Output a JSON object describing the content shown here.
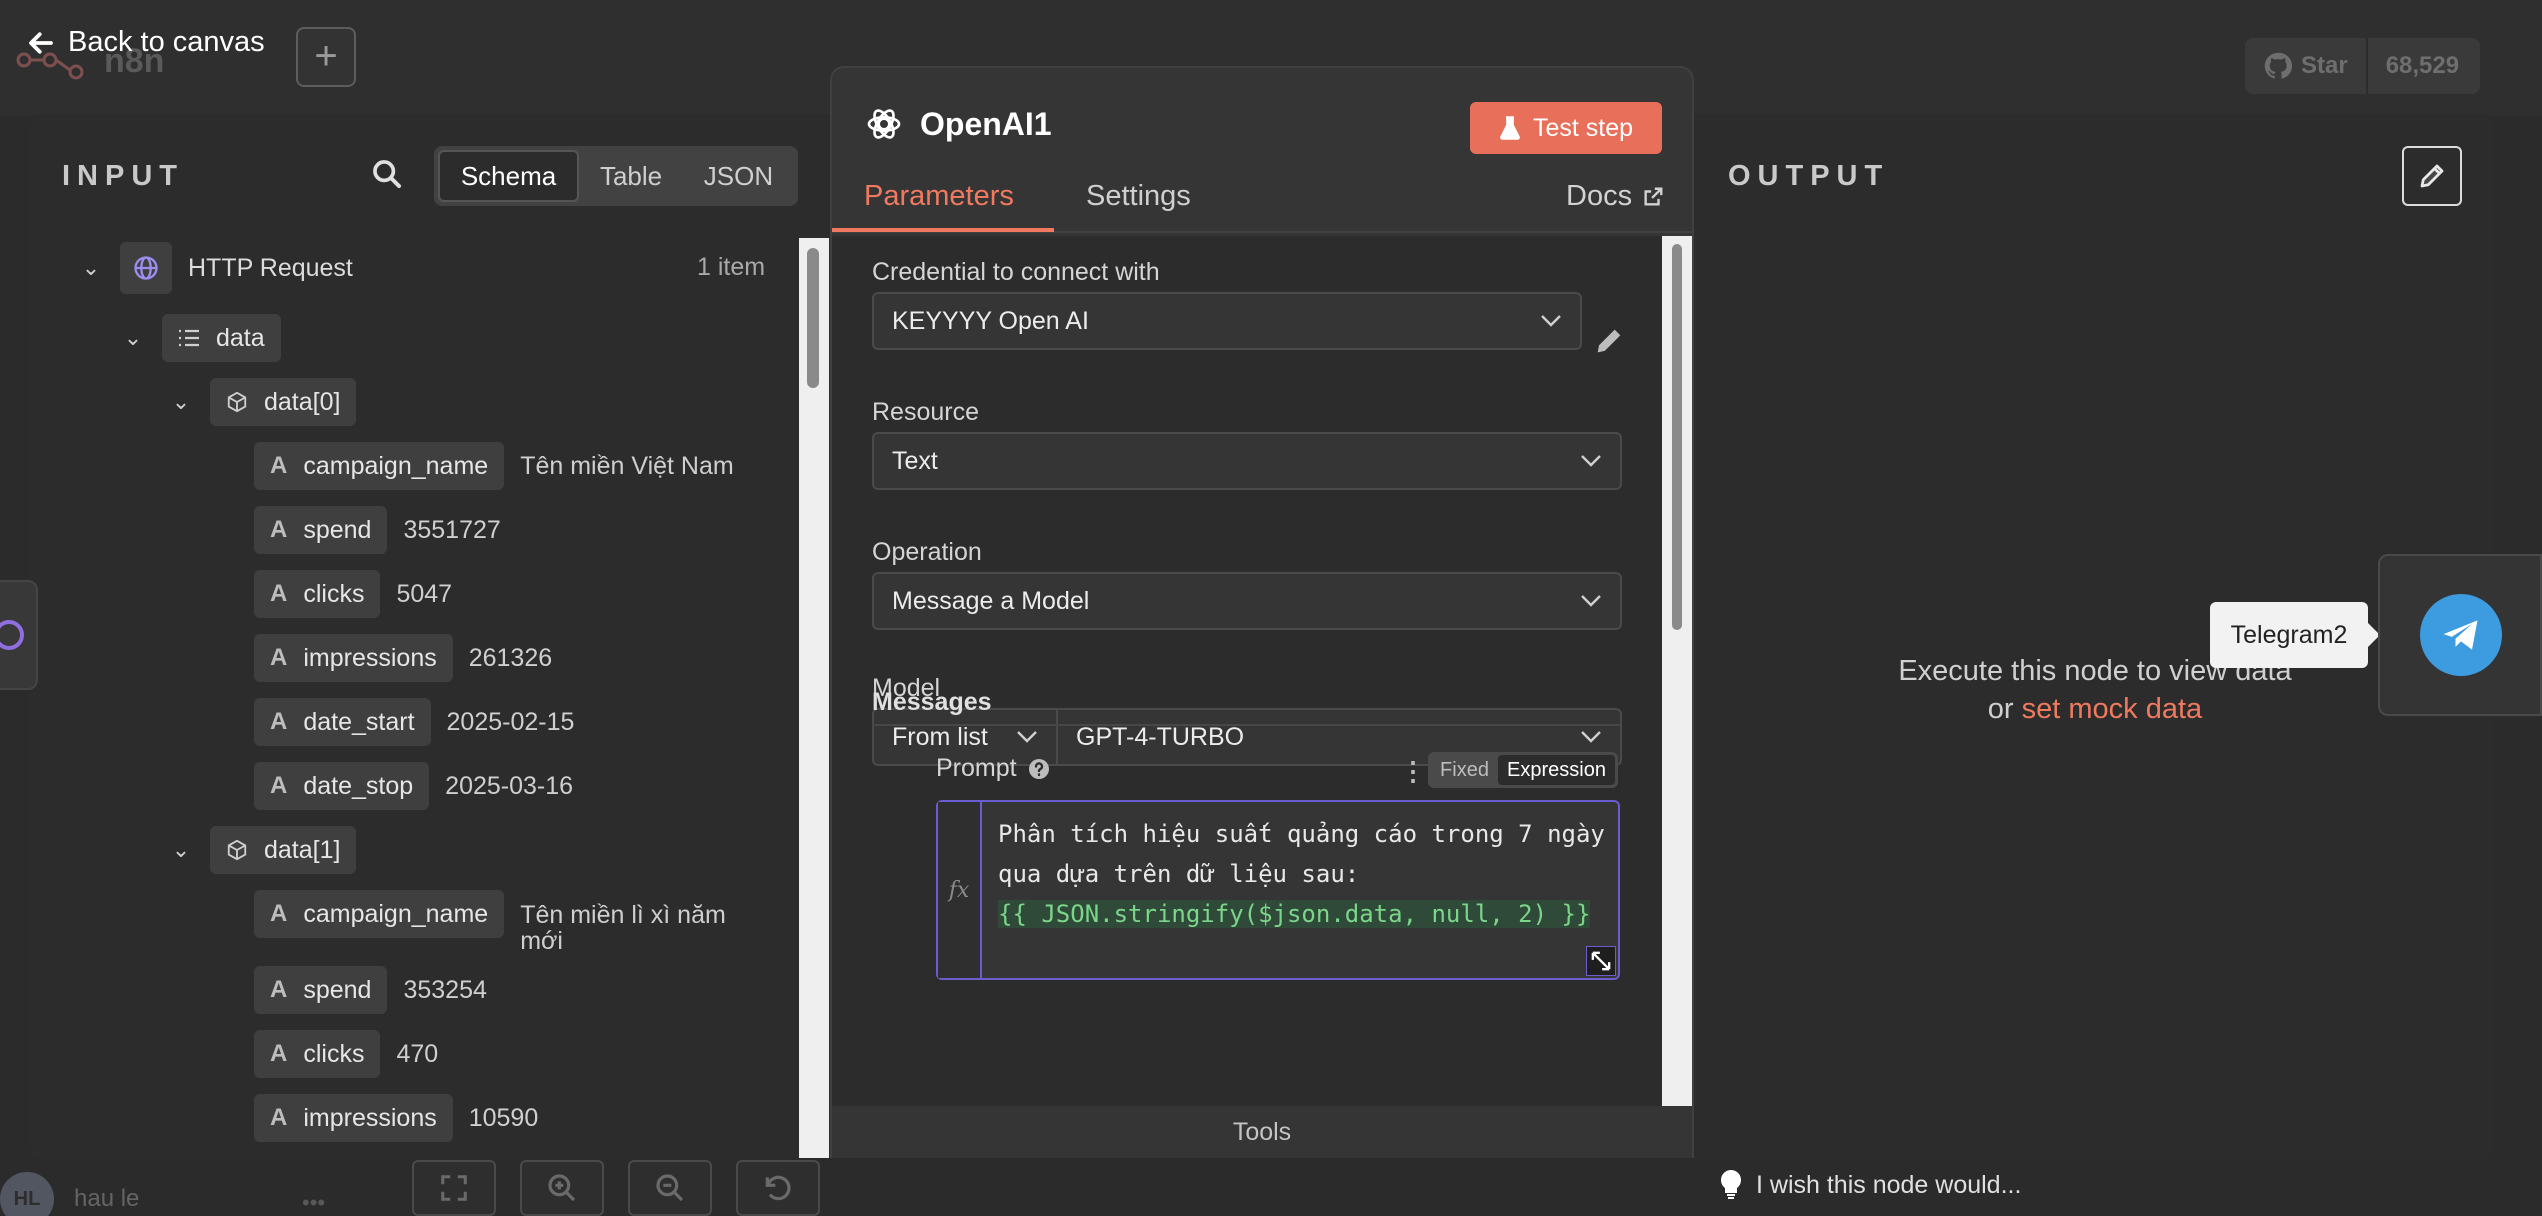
{
  "topbar": {
    "logo_text": "n8n",
    "back_label": "Back to canvas",
    "github": {
      "star_label": "Star",
      "star_count": "68,529"
    }
  },
  "input": {
    "title": "INPUT",
    "views": [
      "Schema",
      "Table",
      "JSON"
    ],
    "active_view": "Schema",
    "node": {
      "name": "HTTP Request",
      "count": "1 item"
    },
    "root_key": "data",
    "groups": [
      {
        "key": "data[0]",
        "fields": [
          {
            "name": "campaign_name",
            "value": "Tên miền Việt Nam"
          },
          {
            "name": "spend",
            "value": "3551727"
          },
          {
            "name": "clicks",
            "value": "5047"
          },
          {
            "name": "impressions",
            "value": "261326"
          },
          {
            "name": "date_start",
            "value": "2025-02-15"
          },
          {
            "name": "date_stop",
            "value": "2025-03-16"
          }
        ]
      },
      {
        "key": "data[1]",
        "fields": [
          {
            "name": "campaign_name",
            "value": "Tên miền lì xì năm mới"
          },
          {
            "name": "spend",
            "value": "353254"
          },
          {
            "name": "clicks",
            "value": "470"
          },
          {
            "name": "impressions",
            "value": "10590"
          }
        ]
      }
    ]
  },
  "dialog": {
    "title": "OpenAI1",
    "test_button": "Test step",
    "tabs": [
      "Parameters",
      "Settings"
    ],
    "docs_label": "Docs",
    "credential": {
      "label": "Credential to connect with",
      "value": "KEYYYY Open AI"
    },
    "resource": {
      "label": "Resource",
      "value": "Text"
    },
    "operation": {
      "label": "Operation",
      "value": "Message a Model"
    },
    "model": {
      "label": "Model",
      "mode": "From list",
      "value": "GPT-4-TURBO"
    },
    "messages_label": "Messages",
    "prompt": {
      "label": "Prompt",
      "mode_options": [
        "Fixed",
        "Expression"
      ],
      "active_mode": "Expression",
      "fx_label": "fx",
      "text_line1": "Phân tích hiệu suất quảng cáo trong 7 ngày",
      "text_line2": "qua dựa trên dữ liệu sau:",
      "code": "{{ JSON.stringify($json.data, null, 2) }}"
    },
    "tools_label": "Tools"
  },
  "output": {
    "title": "OUTPUT",
    "empty_line1": "Execute this node to view data",
    "empty_or": "or",
    "mock_link": "set mock data",
    "next_node_tooltip": "Telegram2"
  },
  "bottom": {
    "avatar_initials": "HL",
    "user_name": "hau le",
    "feedback": "I wish this node would..."
  },
  "colors": {
    "accent": "#ef7a5f",
    "test_button": "#e86f5a",
    "expression_border": "#6b5cd0",
    "telegram": "#3d9be0"
  }
}
